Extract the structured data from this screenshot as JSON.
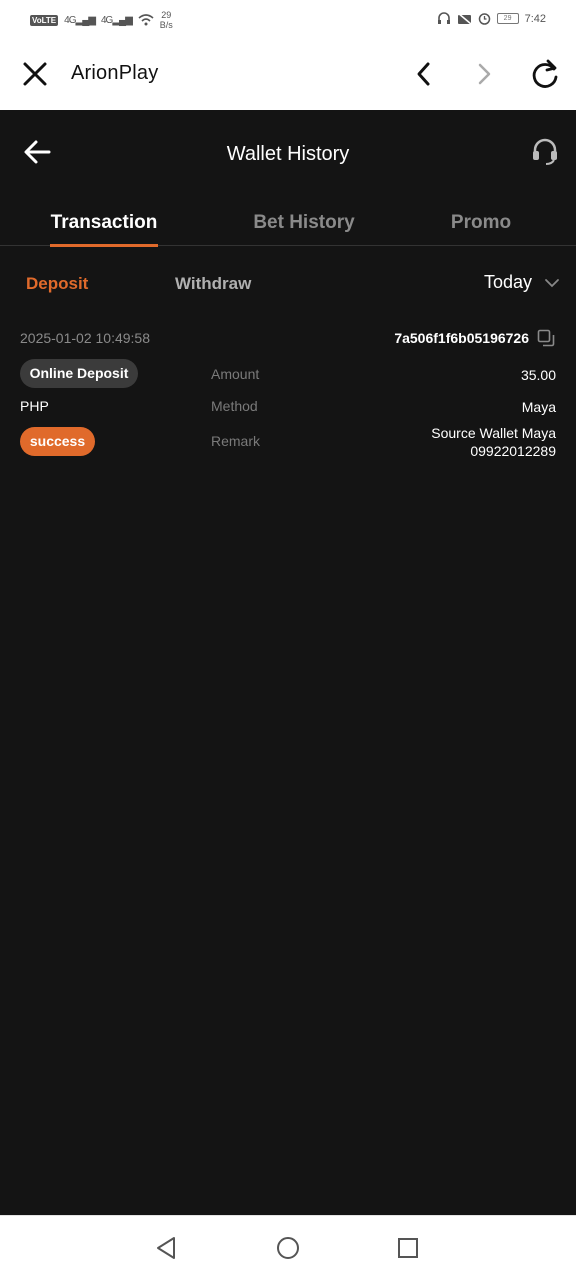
{
  "status_bar": {
    "volte": "VoLTE",
    "net1": "4G",
    "net2": "4G",
    "speed_value": "29",
    "speed_unit": "B/s",
    "battery": "29",
    "time": "7:42"
  },
  "browser": {
    "title": "ArionPlay"
  },
  "app": {
    "title": "Wallet History",
    "tabs": [
      {
        "label": "Transaction",
        "active": true
      },
      {
        "label": "Bet History",
        "active": false
      },
      {
        "label": "Promo",
        "active": false
      }
    ],
    "subtabs": {
      "deposit": "Deposit",
      "withdraw": "Withdraw"
    },
    "date_filter": "Today",
    "transaction": {
      "datetime": "2025-01-02 10:49:58",
      "id": "7a506f1f6b05196726",
      "type": "Online Deposit",
      "currency": "PHP",
      "status": "success",
      "amount_label": "Amount",
      "amount": "35.00",
      "method_label": "Method",
      "method": "Maya",
      "remark_label": "Remark",
      "remark_line1": "Source Wallet Maya",
      "remark_line2": "09922012289"
    }
  },
  "colors": {
    "accent": "#e06a2b",
    "background": "#141414"
  }
}
